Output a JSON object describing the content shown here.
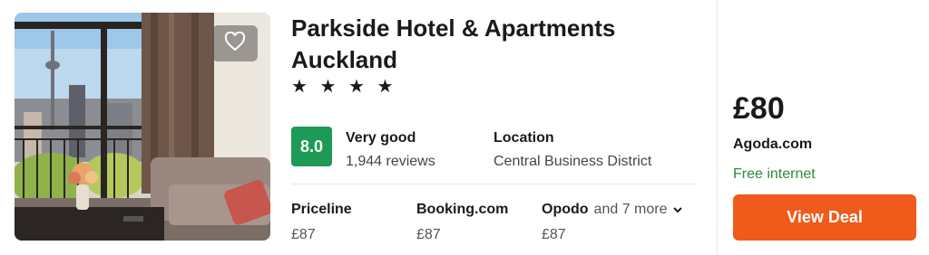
{
  "hotel": {
    "name": "Parkside Hotel & Apartments Auckland",
    "stars_text": "★ ★ ★ ★",
    "star_count": 4
  },
  "rating": {
    "score": "8.0",
    "label": "Very good",
    "reviews": "1,944 reviews",
    "badge_color": "#1d9b54"
  },
  "location": {
    "title": "Location",
    "value": "Central Business District"
  },
  "providers": [
    {
      "name": "Priceline",
      "price": "£87"
    },
    {
      "name": "Booking.com",
      "price": "£87"
    },
    {
      "name": "Opodo",
      "price": "£87"
    }
  ],
  "more_providers": "and 7 more",
  "deal": {
    "price": "£80",
    "site": "Agoda.com",
    "amenity": "Free internet",
    "button_label": "View Deal",
    "button_color": "#f05a1a",
    "amenity_color": "#2e8b3e"
  },
  "icons": {
    "favorite": "heart-outline-icon",
    "expand": "chevron-down-icon"
  }
}
